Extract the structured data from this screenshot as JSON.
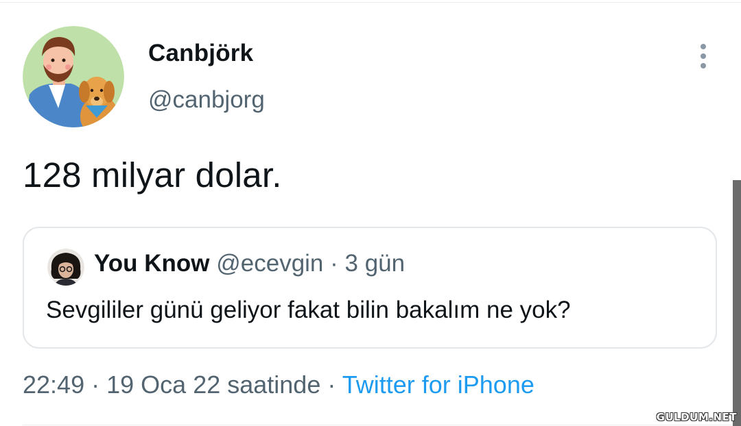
{
  "tweet": {
    "author": {
      "display_name": "Canbjörk",
      "handle": "@canbjorg"
    },
    "text": "128 milyar dolar.",
    "quoted": {
      "display_name": "You Know",
      "handle": "@ecevgin",
      "separator": "·",
      "relative_time": "3 gün",
      "text": "Sevgililer günü geliyor fakat bilin bakalım ne yok?"
    },
    "meta": {
      "time": "22:49",
      "separator": "·",
      "date": "19 Oca 22 saatinde",
      "source": "Twitter for iPhone"
    }
  },
  "icons": {
    "more": "more-vertical-icon"
  },
  "watermark": "GULDUM.NET",
  "colors": {
    "text_primary": "#0f1419",
    "text_secondary": "#536471",
    "link": "#1d9bf0",
    "border": "#e3e7ea",
    "avatar_bg": "#bfe0a8"
  }
}
